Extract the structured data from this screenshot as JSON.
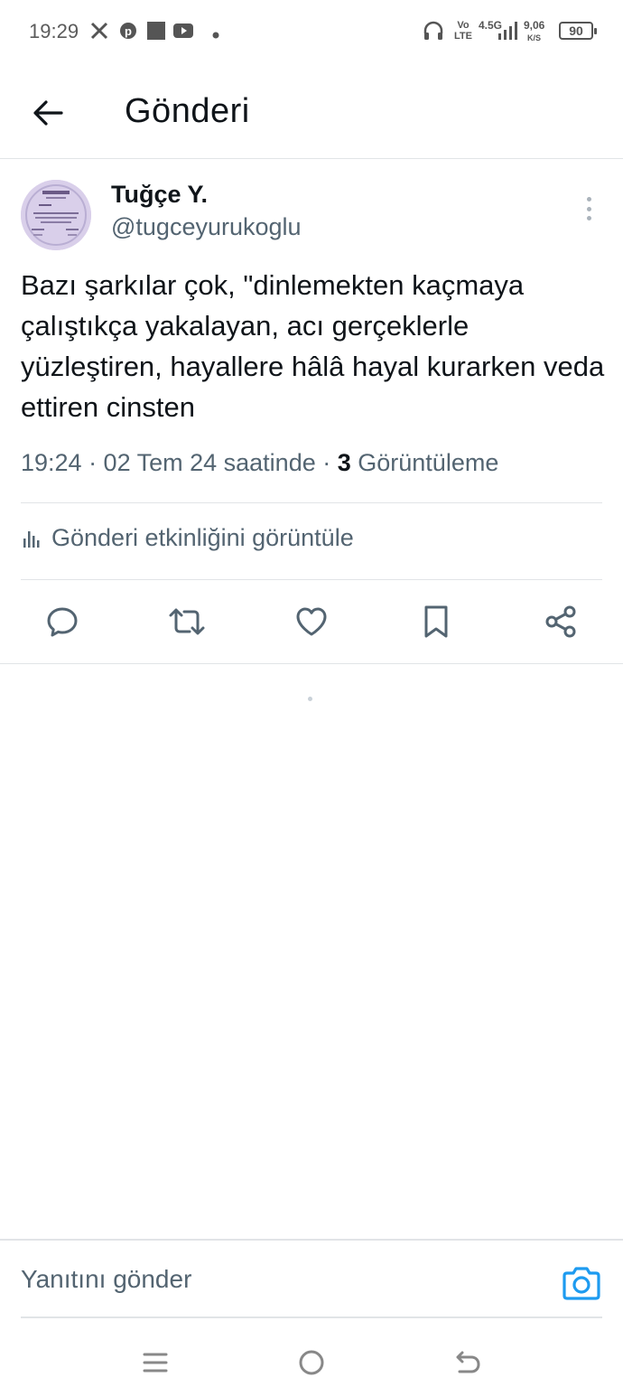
{
  "status_bar": {
    "time": "19:29",
    "notification_icons": [
      "x-icon",
      "pinterest-icon",
      "square-icon",
      "youtube-icon",
      "dot-icon"
    ],
    "vo_lte": "Vo\nLTE",
    "network": "4.5G",
    "speed_value": "9,06",
    "speed_unit": "K/S",
    "battery": "90"
  },
  "header": {
    "title": "Gönderi"
  },
  "post": {
    "author_name": "Tuğçe Y.",
    "author_handle": "@tugceyurukoglu",
    "text": "Bazı şarkılar çok, \"dinlemekten kaçmaya çalıştıkça yakalayan, acı gerçeklerle yüzleştiren, hayallere hâlâ hayal kurarken veda ettiren cinsten",
    "meta_prefix": "19:24 · 02 Tem 24 saatinde · ",
    "views_count": "3",
    "views_label": " Görüntüleme",
    "activity_label": "Gönderi etkinliğini görüntüle"
  },
  "reply": {
    "placeholder": "Yanıtını gönder"
  },
  "colors": {
    "text": "#0f1419",
    "secondary": "#536471",
    "divider": "#e1e4e7",
    "accent": "#1d9bf0"
  }
}
